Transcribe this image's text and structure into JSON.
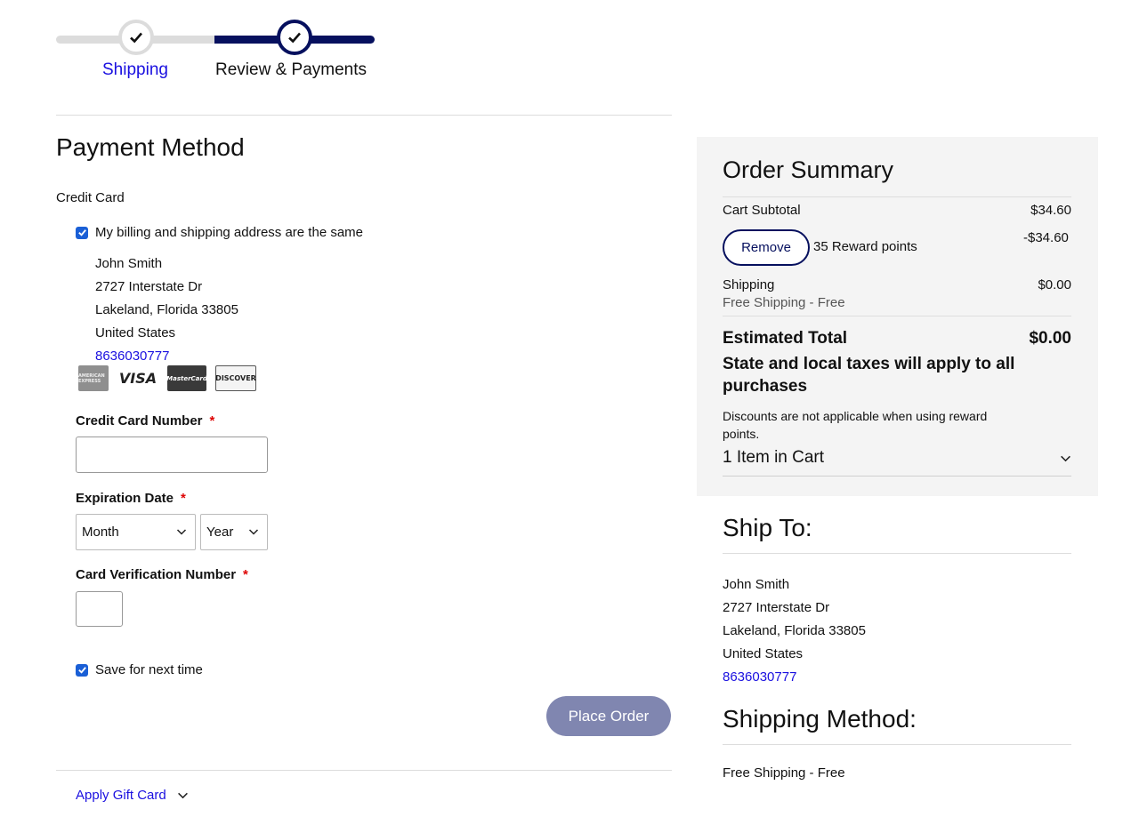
{
  "progress": {
    "steps": [
      {
        "label": "Shipping",
        "state": "complete"
      },
      {
        "label": "Review & Payments",
        "state": "current"
      }
    ]
  },
  "payment": {
    "title": "Payment Method",
    "method_label": "Credit Card",
    "same_address_label": "My billing and shipping address are the same",
    "same_address_checked": true,
    "billing_address": {
      "name": "John Smith",
      "street": "2727 Interstate Dr",
      "city_line": "Lakeland, Florida 33805",
      "country": "United States",
      "phone": "8636030777"
    },
    "card_logos": [
      {
        "name": "amex",
        "text": "AMERICAN EXPRESS"
      },
      {
        "name": "visa",
        "text": "VISA"
      },
      {
        "name": "mastercard",
        "text": "MasterCard"
      },
      {
        "name": "discover",
        "text": "DISCOVER"
      }
    ],
    "card_number_label": "Credit Card Number",
    "card_number_value": "",
    "expiration_label": "Expiration Date",
    "month_value": "Month",
    "year_value": "Year",
    "cvv_label": "Card Verification Number",
    "cvv_value": "",
    "required_mark": "*",
    "save_label": "Save for next time",
    "save_checked": true,
    "place_order_label": "Place Order",
    "gift_card_label": "Apply Gift Card"
  },
  "summary": {
    "title": "Order Summary",
    "subtotal_label": "Cart Subtotal",
    "subtotal_value": "$34.60",
    "remove_label": "Remove",
    "reward_label": "35 Reward points",
    "reward_value": "-$34.60",
    "shipping_label": "Shipping",
    "shipping_detail": "Free Shipping - Free",
    "shipping_value": "$0.00",
    "estimated_label": "Estimated Total",
    "estimated_value": "$0.00",
    "tax_note": "State and local taxes will apply to all purchases",
    "discount_note": "Discounts are not applicable when using reward points.",
    "items_label": "1 Item in Cart"
  },
  "ship_to": {
    "title": "Ship To:",
    "name": "John Smith",
    "street": "2727 Interstate Dr",
    "city_line": "Lakeland, Florida 33805",
    "country": "United States",
    "phone": "8636030777"
  },
  "shipping_method": {
    "title": "Shipping Method:",
    "value": "Free Shipping - Free"
  },
  "colors": {
    "brand_navy": "#06105e",
    "link_blue": "#1a10e0",
    "checkbox_blue": "#1a5fd6",
    "place_order_disabled": "#8086b0",
    "summary_bg": "#f4f4f4"
  }
}
